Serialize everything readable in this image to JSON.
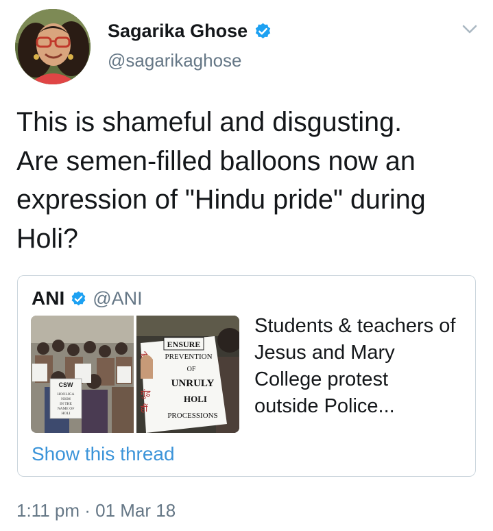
{
  "author": {
    "display_name": "Sagarika Ghose",
    "handle": "@sagarikaghose",
    "verified": true
  },
  "tweet": {
    "text": "This is shameful and disgusting.\nAre semen-filled balloons now an\nexpression of \"Hindu pride\" during\nHoli?",
    "timestamp": "1:11 pm · 01 Mar 18"
  },
  "quoted_tweet": {
    "name": "ANI",
    "handle": "@ANI",
    "verified": true,
    "text": "Students & teachers of\nJesus and Mary\nCollege protest\noutside Police...",
    "show_thread_label": "Show this thread",
    "media": {
      "left_sign_lines": [
        "CSW",
        "HOOLIGA",
        "NISM",
        "IN THE",
        "NAME OF",
        "HOLI"
      ],
      "right_sign_lines": [
        "ENSURE",
        "PREVENTION",
        "OF",
        "UNRULY",
        "HOLI",
        "PROCESSIONS"
      ],
      "right_sign_devanagari": [
        "हो",
        "गुंड",
        "हीं"
      ]
    }
  },
  "colors": {
    "verified_blue": "#1da1f2",
    "secondary_text": "#657786",
    "link": "#3b94d9",
    "border": "#ccd6dd"
  },
  "icons": {
    "verified": "verified-badge-icon",
    "caret": "chevron-down-icon"
  }
}
